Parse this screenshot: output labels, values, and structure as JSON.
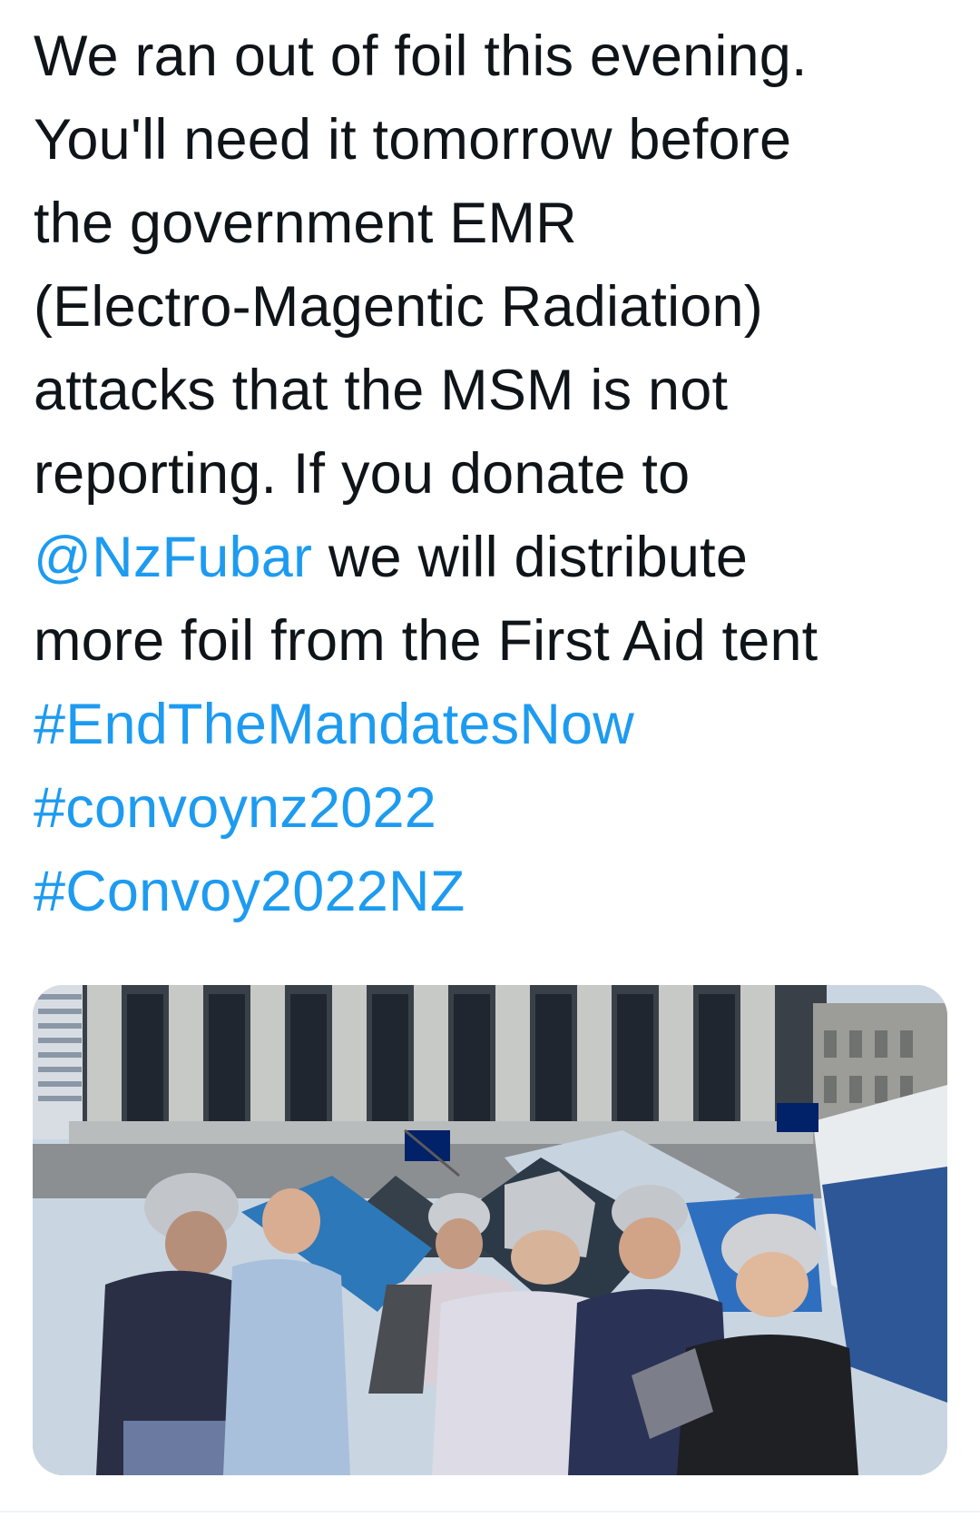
{
  "tweet": {
    "lines": [
      "We ran out of foil this evening.",
      "You'll need it tomorrow before",
      "the government EMR",
      "(Electro-Magentic Radiation)",
      "attacks that the MSM is not",
      "reporting. If you donate to"
    ],
    "mention": "@NzFubar",
    "line7_rest": " we will distribute",
    "line8": "more foil from the First Aid tent",
    "hashtags": [
      "#EndTheMandatesNow",
      "#convoynz2022",
      "#Convoy2022NZ"
    ]
  },
  "colors": {
    "text": "#0f1419",
    "link": "#1d9bf0",
    "background": "#ffffff"
  }
}
